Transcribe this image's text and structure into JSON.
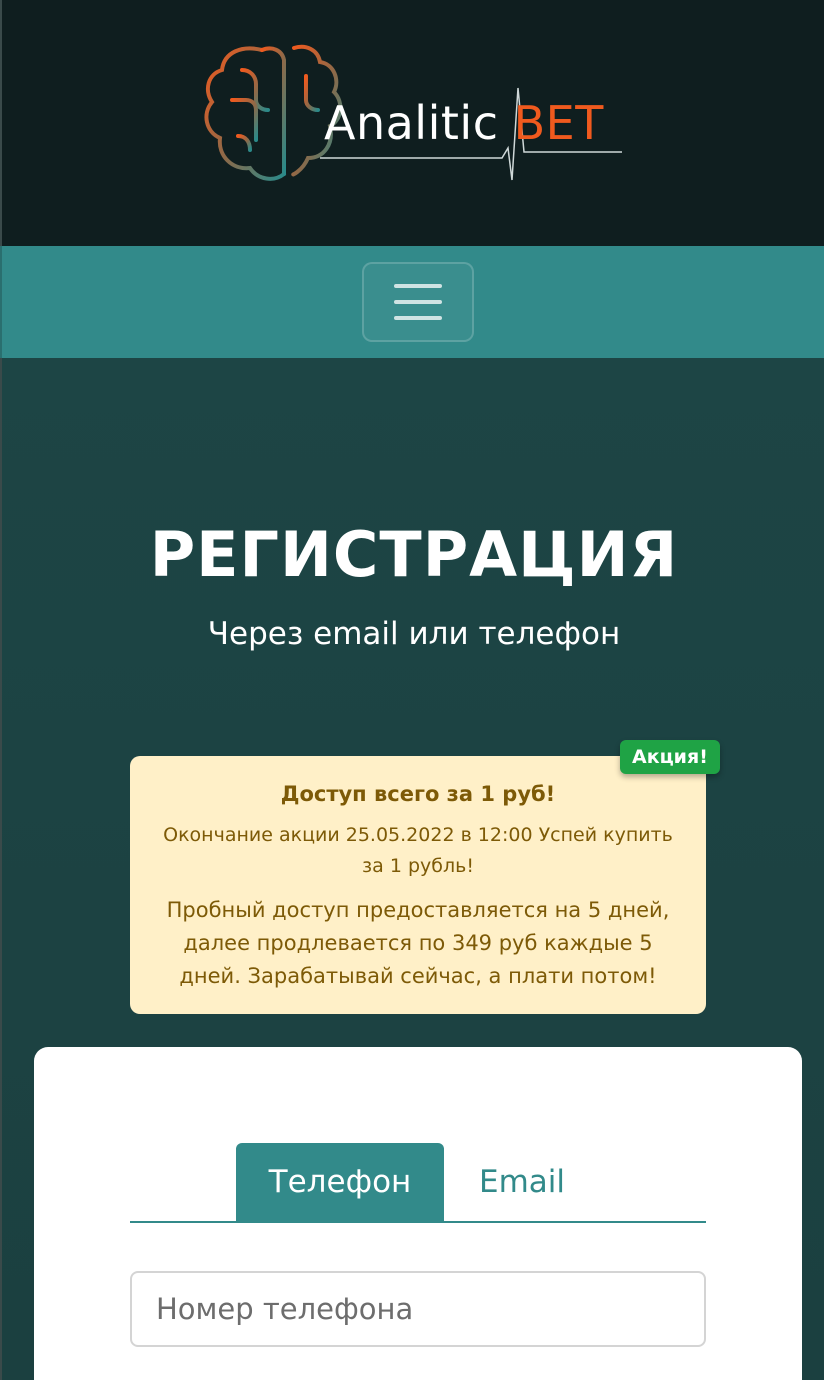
{
  "header": {
    "logo_text_main": "Analitic",
    "logo_text_accent": "BET",
    "logo_icon": "brain-icon",
    "colors": {
      "background": "#0f1e1f",
      "accent": "#f05a1e",
      "teal": "#328a8a"
    }
  },
  "navbar": {
    "menu_icon": "hamburger-menu-icon",
    "background": "#328a8a"
  },
  "hero": {
    "title": "РЕГИСТРАЦИЯ",
    "subtitle": "Через email или телефон"
  },
  "promo": {
    "badge": "Акция!",
    "title": "Доступ всего за 1 руб!",
    "line1": "Окончание акции 25.05.2022 в 12:00 Успей купить за 1 рубль!",
    "line2": "Пробный доступ предоставляется на 5 дней, далее продлевается по 349 руб каждые 5 дней. Зарабатывай сейчас, а плати потом!",
    "colors": {
      "background": "#fff0c8",
      "text": "#7d5a07",
      "badge": "#1fa345"
    }
  },
  "form": {
    "tabs": [
      {
        "label": "Телефон",
        "active": true
      },
      {
        "label": "Email",
        "active": false
      }
    ],
    "phone_placeholder": "Номер телефона"
  }
}
